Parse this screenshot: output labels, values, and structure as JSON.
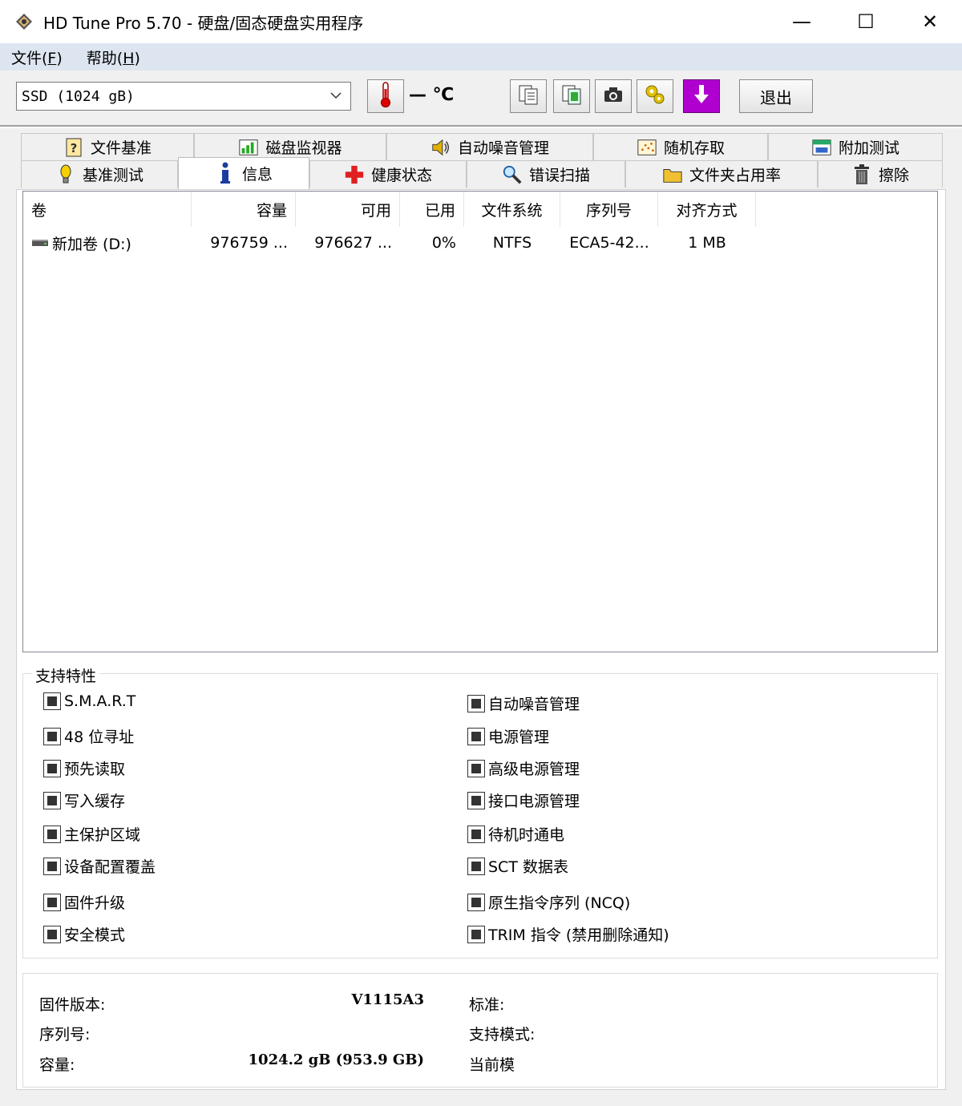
{
  "window": {
    "title": "HD Tune Pro 5.70 - 硬盘/固态硬盘实用程序",
    "minimize": "—",
    "maximize": "☐",
    "close": "✕"
  },
  "menu": {
    "file": "文件(",
    "file_key": "F",
    "file_end": ")",
    "help": "帮助(",
    "help_key": "H",
    "help_end": ")"
  },
  "toolbar": {
    "drive": "SSD (1024 gB)",
    "temperature": "— ℃",
    "exit_label": "退出",
    "icons": [
      "thermometer-icon",
      "copy-text-icon",
      "copy-screen-icon",
      "camera-icon",
      "options-icon",
      "save-icon"
    ]
  },
  "tabs": {
    "row1": [
      {
        "label": "文件基准",
        "icon": "file-benchmark-icon"
      },
      {
        "label": "磁盘监视器",
        "icon": "disk-monitor-icon"
      },
      {
        "label": "自动噪音管理",
        "icon": "speaker-icon"
      },
      {
        "label": "随机存取",
        "icon": "random-access-icon"
      },
      {
        "label": "附加测试",
        "icon": "extra-tests-icon"
      }
    ],
    "row2": [
      {
        "label": "基准测试",
        "icon": "benchmark-bulb-icon"
      },
      {
        "label": "信息",
        "icon": "info-icon",
        "active": true
      },
      {
        "label": "健康状态",
        "icon": "health-cross-icon"
      },
      {
        "label": "错误扫描",
        "icon": "magnifier-icon"
      },
      {
        "label": "文件夹占用率",
        "icon": "folder-icon"
      },
      {
        "label": "擦除",
        "icon": "trash-icon"
      }
    ]
  },
  "volumes": {
    "columns": [
      "卷",
      "容量",
      "可用",
      "已用",
      "文件系统",
      "序列号",
      "对齐方式"
    ],
    "rows": [
      {
        "name": "新加卷 (D:)",
        "capacity": "976759 ...",
        "free": "976627 ...",
        "used": "0%",
        "fs": "NTFS",
        "serial": "ECA5-42...",
        "align": "1 MB"
      }
    ]
  },
  "features": {
    "title": "支持特性",
    "left": [
      "S.M.A.R.T",
      "48 位寻址",
      "预先读取",
      "写入缓存",
      "主保护区域",
      "设备配置覆盖",
      "固件升级",
      "安全模式"
    ],
    "right": [
      "自动噪音管理",
      "电源管理",
      "高级电源管理",
      "接口电源管理",
      "待机时通电",
      "SCT 数据表",
      "原生指令序列 (NCQ)",
      "TRIM 指令 (禁用删除通知)"
    ]
  },
  "info": {
    "firmware_label": "固件版本:",
    "firmware_value": "V1115A3",
    "serial_label": "序列号:",
    "serial_value": "",
    "capacity_label": "容量:",
    "capacity_value": "1024.2 gB (953.9 GB)",
    "standard_label": "标准:",
    "support_mode_label": "支持模式:",
    "current_mode_label": "当前模"
  },
  "colors": {
    "menubar_bg": "#dde6f0",
    "window_bg": "#f0f0f0",
    "panel_bg": "#ffffff",
    "save_button_bg": "#b000d0"
  }
}
